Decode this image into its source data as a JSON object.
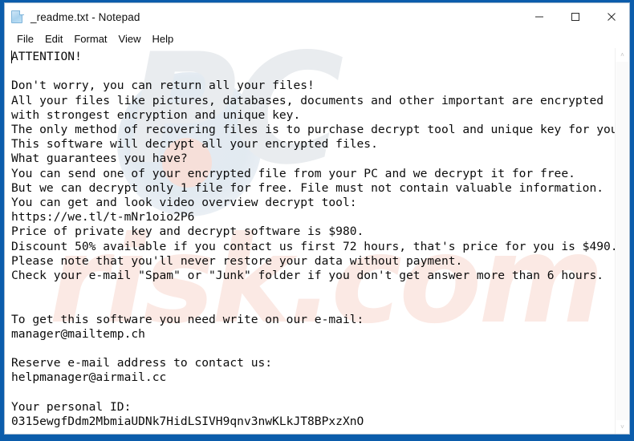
{
  "window": {
    "title": "_readme.txt - Notepad",
    "icon": "notepad-document-icon",
    "border_color": "#0b5cab",
    "controls": {
      "minimize": "Minimize",
      "maximize": "Maximize",
      "close": "Close"
    }
  },
  "menubar": {
    "items": [
      {
        "label": "File"
      },
      {
        "label": "Edit"
      },
      {
        "label": "Format"
      },
      {
        "label": "View"
      },
      {
        "label": "Help"
      }
    ]
  },
  "watermark": {
    "primary": "PC",
    "secondary": "risk.com",
    "primary_color": "#e9ecef",
    "secondary_color": "#fbe9e4"
  },
  "scrollbar": {
    "up_arrow": "˄",
    "down_arrow": "˅",
    "orientation": "vertical"
  },
  "document": {
    "filename": "_readme.txt",
    "ransom_note": {
      "heading": "ATTENTION!",
      "url": "https://we.tl/t-mNr1oio2P6",
      "price_full": "$980",
      "price_discount": "$490",
      "discount_percent": "50%",
      "discount_window_hours": "72",
      "reply_time_hours": "6",
      "free_decrypt_files": "1",
      "email_primary": "manager@mailtemp.ch",
      "email_reserve": "helpmanager@airmail.cc",
      "personal_id": "0315ewgfDdm2MbmiaUDNk7HidLSIVH9qnv3nwKLkJT8BPxzXnO"
    },
    "text": "ATTENTION!\n\nDon't worry, you can return all your files!\nAll your files like pictures, databases, documents and other important are encrypted\nwith strongest encryption and unique key.\nThe only method of recovering files is to purchase decrypt tool and unique key for you.\nThis software will decrypt all your encrypted files.\nWhat guarantees you have?\nYou can send one of your encrypted file from your PC and we decrypt it for free.\nBut we can decrypt only 1 file for free. File must not contain valuable information.\nYou can get and look video overview decrypt tool:\nhttps://we.tl/t-mNr1oio2P6\nPrice of private key and decrypt software is $980.\nDiscount 50% available if you contact us first 72 hours, that's price for you is $490.\nPlease note that you'll never restore your data without payment.\nCheck your e-mail \"Spam\" or \"Junk\" folder if you don't get answer more than 6 hours.\n\n\nTo get this software you need write on our e-mail:\nmanager@mailtemp.ch\n\nReserve e-mail address to contact us:\nhelpmanager@airmail.cc\n\nYour personal ID:\n0315ewgfDdm2MbmiaUDNk7HidLSIVH9qnv3nwKLkJT8BPxzXnO"
  }
}
